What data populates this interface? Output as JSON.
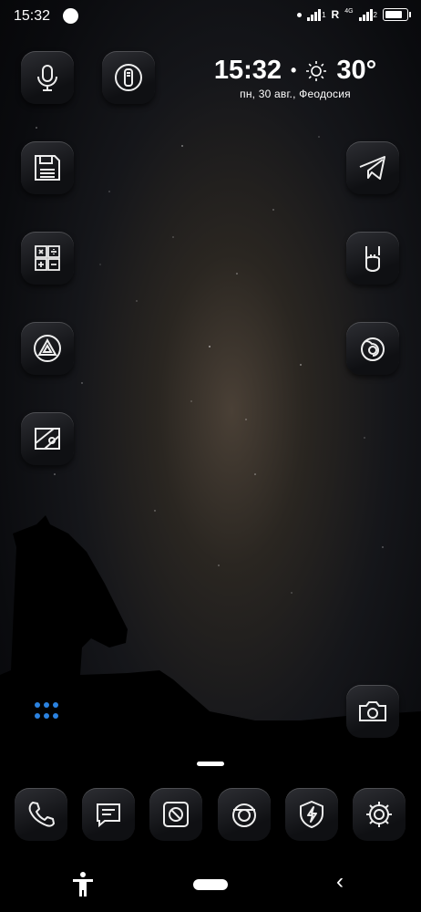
{
  "status_bar": {
    "time": "15:32",
    "roaming": "R",
    "network": "4G",
    "sim1": "1",
    "sim2": "2"
  },
  "clock_widget": {
    "time": "15:32",
    "temperature": "30°",
    "date_location": "пн, 30 авг., Феодосия"
  },
  "home_icons": [
    "microphone-icon",
    "flashlight-icon",
    "floppy-disk-icon",
    "calculator-icon",
    "delta-logo-icon",
    "map-icon",
    "telegram-icon",
    "rock-hand-icon",
    "firefox-icon",
    "camera-icon"
  ],
  "dock_icons": [
    "phone-icon",
    "messages-icon",
    "gallery-icon",
    "camera-lens-icon",
    "shield-bolt-icon",
    "settings-icon"
  ],
  "colors": {
    "accent": "#2b82e0",
    "icon_bg": "#1a1b1f"
  }
}
